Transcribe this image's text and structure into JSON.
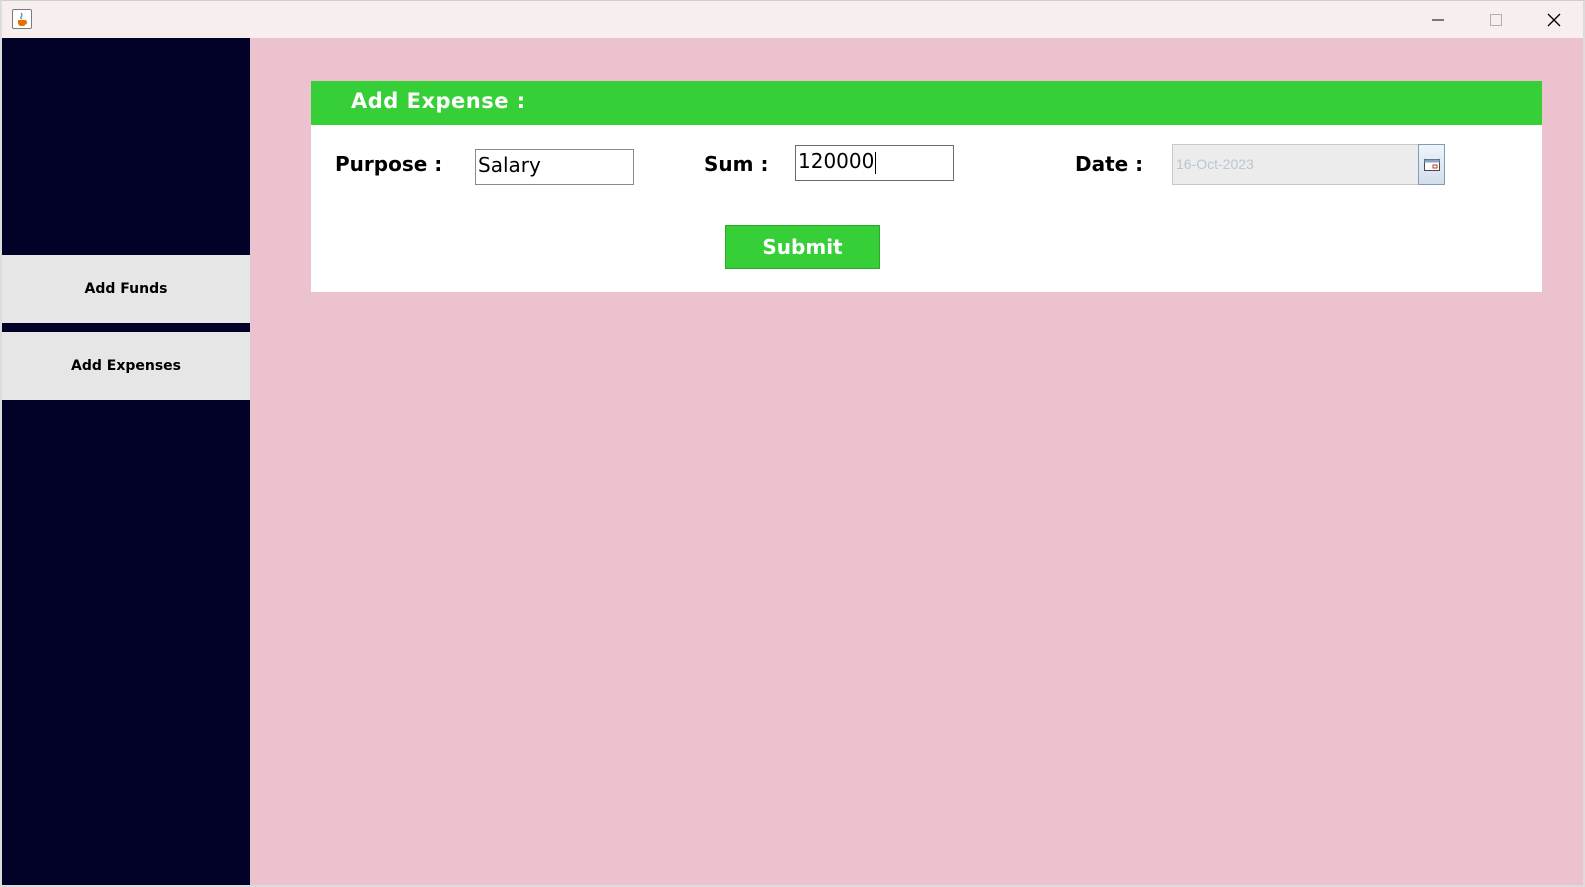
{
  "window": {
    "icon": "java-coffee-icon",
    "controls": {
      "minimize_icon": "minimize-icon",
      "maximize_icon": "maximize-icon",
      "close_icon": "close-icon"
    }
  },
  "sidebar": {
    "items": [
      {
        "label": "Add Funds"
      },
      {
        "label": "Add Expenses"
      }
    ]
  },
  "panel": {
    "title": "Add Expense :",
    "purpose": {
      "label": "Purpose :",
      "value": "Salary"
    },
    "sum": {
      "label": "Sum :",
      "value": "120000"
    },
    "date": {
      "label": "Date :",
      "value": "16-Oct-2023",
      "picker_icon": "calendar-icon"
    },
    "submit_label": "Submit"
  },
  "colors": {
    "sidebar_bg": "#020229",
    "main_bg": "#ebc2cd",
    "accent_green": "#37cf38",
    "menu_button_bg": "#e6e6e6"
  }
}
